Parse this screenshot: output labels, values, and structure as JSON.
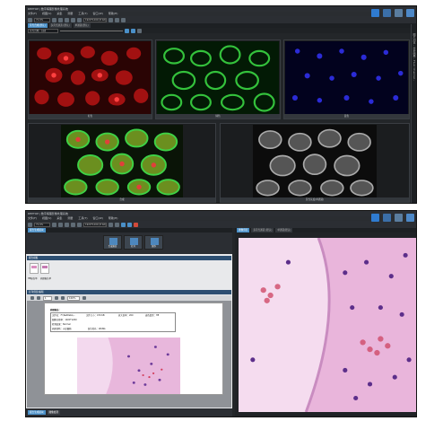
{
  "top_window": {
    "title": "DEPTOP | 数字病理影像处理系统",
    "menu": [
      "文件(F)",
      "视图(V)",
      "采集",
      "测量",
      "工具(T)",
      "窗口(W)",
      "帮助(H)"
    ],
    "zoom": "71.0%",
    "resolution": "1920*1200 (8 bit)",
    "tabs": [
      "荧光合成(默认)",
      "多荧光通道 (默认)",
      "单通道(默认)"
    ],
    "view_mode": "荧光合成 - 自动",
    "channel_captions": [
      "红色",
      "绿色",
      "蓝色",
      "合成",
      "荧光灰度(单通道)"
    ],
    "side_tab": "图片浏览 - 分析结果 - Fluor Channel -"
  },
  "bottom_window": {
    "title": "DEPTOP | 数字病理影像处理系统",
    "menu": [
      "文件(F)",
      "视图(V)",
      "采集",
      "测量",
      "工具(T)",
      "窗口(W)",
      "帮助(H)"
    ],
    "zoom": "71.0%",
    "resolution": "1920*1200 (8 bit)",
    "left_tab": "报告生成模块",
    "right_tabs": [
      "图像预览",
      "多荧光通道 (默认)",
      "单通道(默认)"
    ],
    "action_buttons": [
      "生成报告",
      "打开",
      "保存"
    ],
    "section_templates": "报告模板",
    "template_labels": [
      "HE报告单",
      "病理报告单"
    ],
    "section_preview": "打印预览/编辑",
    "page_indicator": "1",
    "page_zoom": "100%",
    "form": {
      "heading": "病理报告：",
      "row1_a": "文件名：F:\\TestData\\...",
      "row1_b": "文件大小：470 KB",
      "row1_c": "放大倍率：20X",
      "row1_d": "染色类型：HE",
      "row2": "图像分辨率：1920*1200",
      "row3": "检测结果：Normal",
      "row4_a": "病理诊断：炎症细胞",
      "row4_b": "医生签名：WANG"
    },
    "status_tabs": [
      "报告生成模块",
      "图像处理"
    ]
  },
  "colors": {
    "accent": "#4a90c8",
    "section": "#2d4f72",
    "dark_bg": "#232629"
  }
}
